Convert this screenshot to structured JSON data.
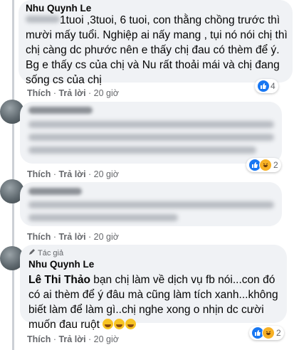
{
  "comment1": {
    "author": "Nhu Quynh Le",
    "text": "1tuoi ,3tuoi, 6 tuoi, con thằng chồng trước thì mười mấy tuổi. Nghiệp ai nấy mang , tụi nó nói chị thì chị càng dc phước nên e thấy chị đau có thèm để ý. Bg e thấy cs của chị và Nu rất thoải mái và chị đang sống cs của chị",
    "like_label": "Thích",
    "reply_label": "Trả lời",
    "time": "20 giờ",
    "reaction_count": "4"
  },
  "comment2": {
    "like_label": "Thích",
    "reply_label": "Trả lời",
    "time": "20 giờ",
    "reaction_count": "2"
  },
  "comment3": {
    "like_label": "Thích",
    "reply_label": "Trả lời",
    "time": "20 giờ"
  },
  "comment4": {
    "badge": "Tác giả",
    "author": "Nhu Quynh Le",
    "mention": "Lê Thi Thảo",
    "text": " bạn chị làm về dịch vụ fb nói...con đó có ai thèm để ý đâu mà cũng làm tích xanh...không biết làm để làm gì..chị nghe xong o nhịn dc cười muốn đau ruột",
    "like_label": "Thích",
    "reply_label": "Trả lời",
    "time": "20 giờ",
    "reaction_count": "2"
  },
  "icons": {
    "like": "like-icon",
    "haha": "haha-icon",
    "author_badge": "pen-icon"
  },
  "colors": {
    "bubble": "#f0f2f5",
    "like": "#1877f2",
    "meta": "#65676b"
  }
}
